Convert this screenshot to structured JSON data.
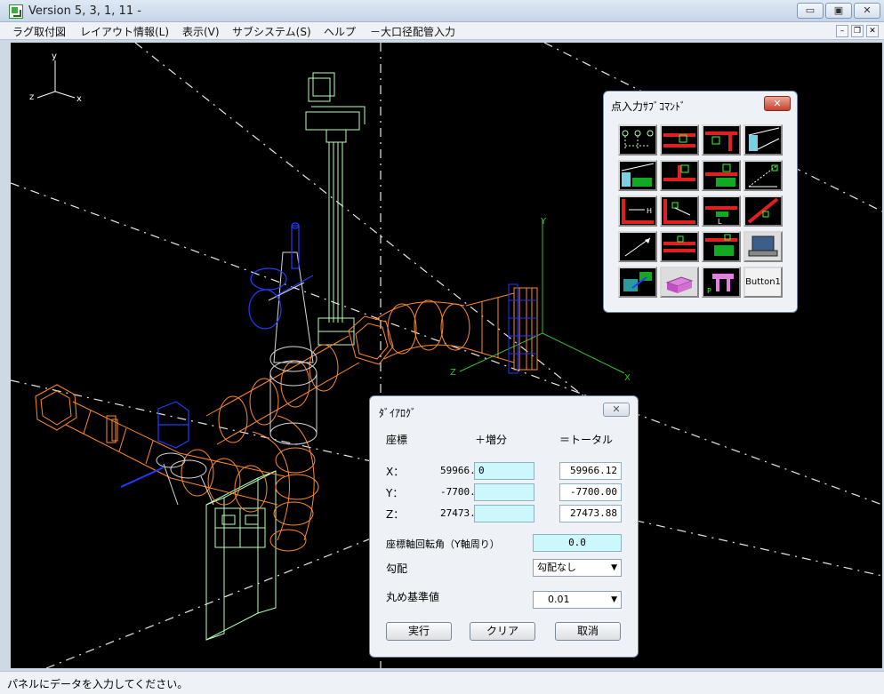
{
  "window": {
    "title": "Version 5, 3, 1, 11 -",
    "controls": {
      "minimize": "▭",
      "restore": "▣",
      "close": "✕"
    },
    "mdi_controls": {
      "minimize": "–",
      "restore": "❐",
      "close": "✕"
    }
  },
  "menu": {
    "items": [
      "ラグ取付図",
      "レイアウト情報(L)",
      "表示(V)",
      "サブシステム(S)",
      "ヘルプ",
      "－大口径配管入力"
    ]
  },
  "viewport": {
    "axis_small": {
      "y": "y",
      "x": "x",
      "z": "z"
    },
    "axis_main": {
      "y": "Y",
      "x": "X",
      "z": "Z"
    },
    "colors": {
      "background": "#000000",
      "pipe": "#ff8a2a",
      "support": "#b8ffb8",
      "valve": "#1f3cff",
      "structure": "#d8d8d8",
      "axis": "#2fbf2f"
    }
  },
  "point_palette": {
    "title": "点入力ｻﾌﾞｺﾏﾝﾄﾞ",
    "close_label": "✕",
    "button_icons": [
      "point-grid-icon",
      "red-line-point-icon",
      "red-corner-point-icon",
      "panel-diagonal-icon",
      "block-line-icon",
      "red-tee-point-icon",
      "red-tee-block-icon",
      "diagonal-point-icon",
      "frame-h-icon",
      "frame-offset-icon",
      "red-dim-l-icon",
      "red-diagonal-icon",
      "arrow-diagonal-icon",
      "red-double-point-icon",
      "red-double-block-icon",
      "laptop-icon",
      "view-arrow-icon",
      "box-3d-icon",
      "support-t-icon"
    ],
    "text_button": "Button1"
  },
  "dialog": {
    "title": "ﾀﾞｲｱﾛｸﾞ",
    "close_label": "✕",
    "headers": {
      "coord": "座標",
      "increment": "＋増分",
      "total": "＝トータル"
    },
    "rows": [
      {
        "label": "X：",
        "value": "59966.12",
        "increment": "0",
        "total": "59966.12"
      },
      {
        "label": "Y：",
        "value": "-7700.00",
        "increment": "",
        "total": "-7700.00"
      },
      {
        "label": "Z：",
        "value": "27473.88",
        "increment": "",
        "total": "27473.88"
      }
    ],
    "rotation": {
      "label": "座標軸回転角（Y軸周り）",
      "value": "0.0"
    },
    "slope": {
      "label": "勾配",
      "value": "勾配なし"
    },
    "rounding": {
      "label": "丸め基準値",
      "value": "0.01"
    },
    "buttons": {
      "execute": "実行",
      "clear": "クリア",
      "cancel": "取消"
    }
  },
  "status": {
    "message": "パネルにデータを入力してください。"
  }
}
